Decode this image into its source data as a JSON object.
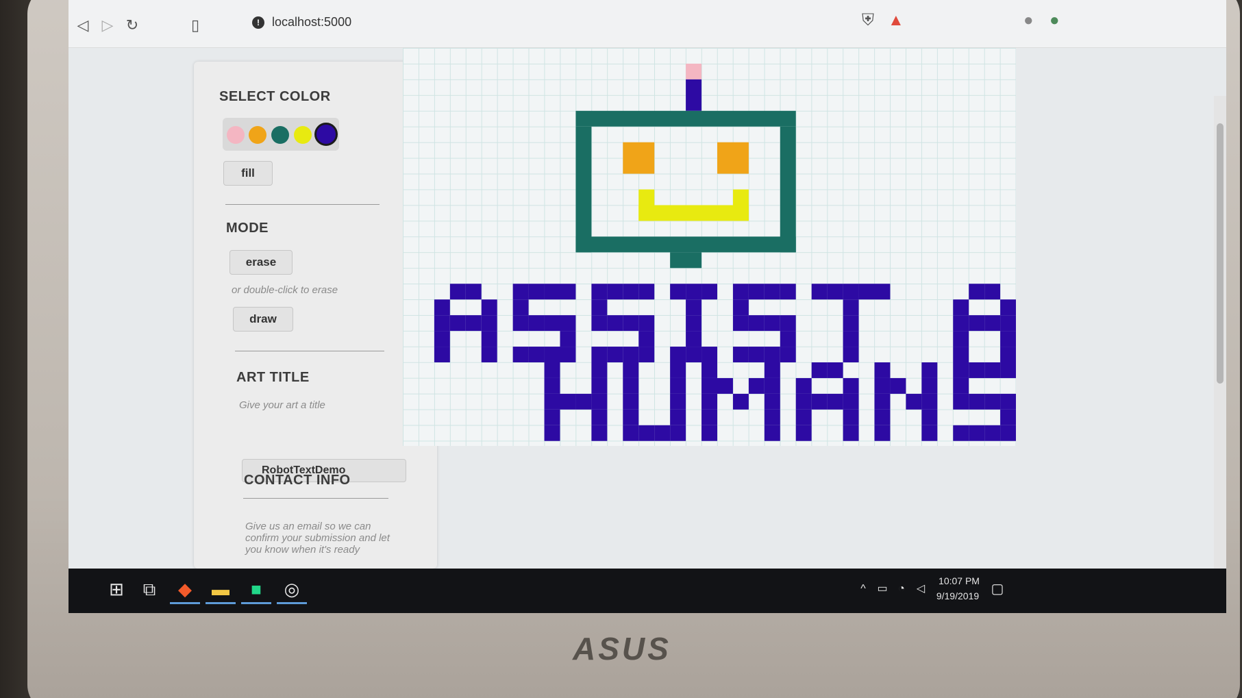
{
  "browser": {
    "url": "localhost:5000",
    "back_icon": "back-icon",
    "forward_icon": "forward-icon",
    "reload_icon": "reload-icon"
  },
  "sidebar": {
    "select_color": {
      "title": "SELECT COLOR",
      "colors": [
        "#f4b6c2",
        "#f0a418",
        "#1a6e63",
        "#e8ea10",
        "#2d0aa3"
      ],
      "selected_index": 4,
      "fill_label": "fill"
    },
    "mode": {
      "title": "MODE",
      "erase_label": "erase",
      "erase_hint": "or double-click to erase",
      "draw_label": "draw"
    },
    "art_title": {
      "title": "ART TITLE",
      "hint": "Give your art a title",
      "value": "RobotTextDemo"
    },
    "contact": {
      "title": "CONTACT INFO",
      "hint": "Give us an email so we can confirm your submission and let you know when it's ready"
    }
  },
  "canvas": {
    "colors": {
      "pink": "#f4b6c2",
      "orange": "#f0a418",
      "teal": "#1a6e63",
      "yellow": "#e8ea10",
      "indigo": "#2d0aa3"
    },
    "text_line_1": "ASSIST ALL",
    "text_line_2": "HUMANS"
  },
  "taskbar": {
    "time": "10:07 PM",
    "date": "9/19/2019"
  },
  "device": {
    "brand": "ASUS"
  }
}
